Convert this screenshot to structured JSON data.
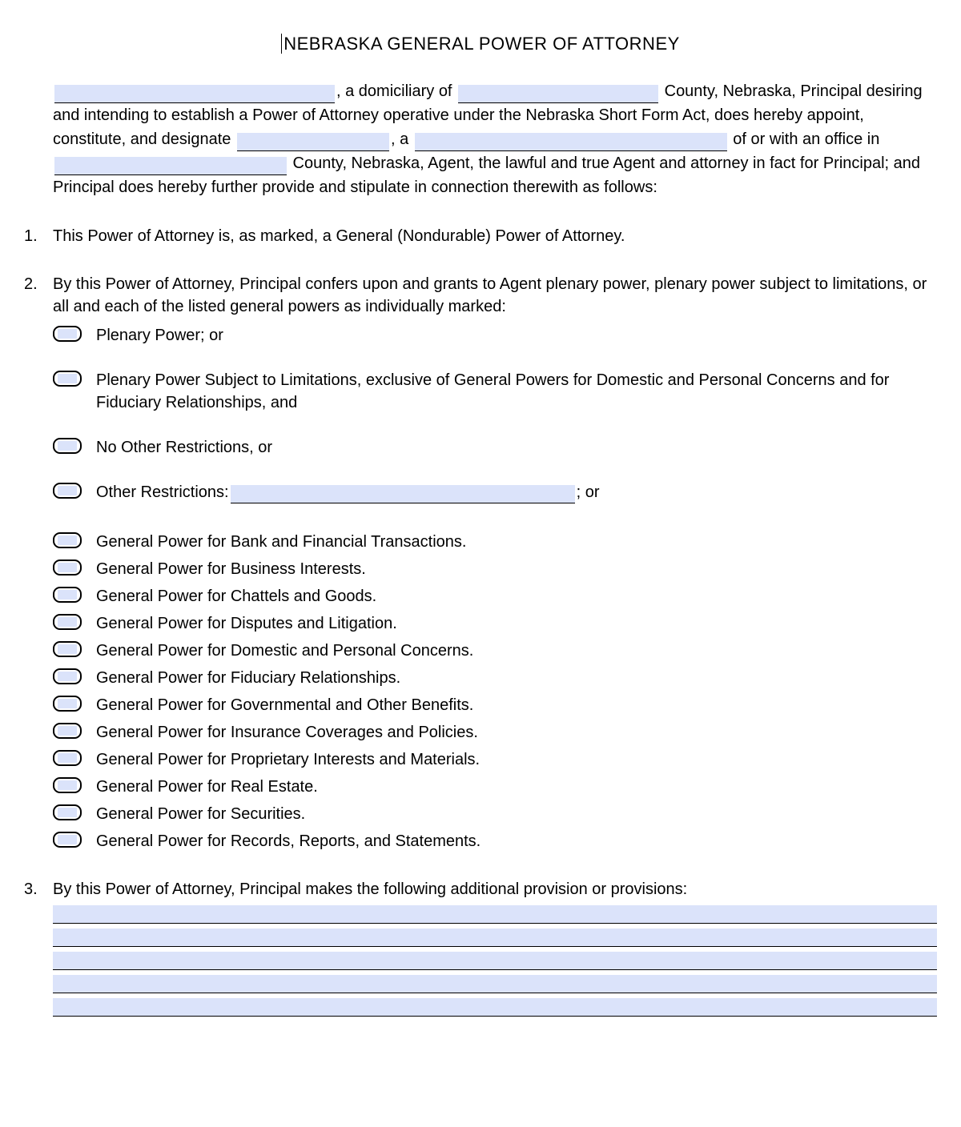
{
  "title": "NEBRASKA GENERAL POWER OF ATTORNEY",
  "intro": {
    "t1": ", a domiciliary of ",
    "t2": " County, Nebraska, Principal desiring and intending to establish a Power of Attorney operative under the Nebraska Short Form Act, does hereby appoint, constitute, and designate ",
    "t3": ", a ",
    "t4": " of or with an office in ",
    "t5": " County, Nebraska, Agent, the lawful and true Agent and attorney in fact for Principal; and Principal does hereby further provide and stipulate in connection therewith as follows:"
  },
  "items": {
    "n1": "1.",
    "n2": "2.",
    "n3": "3.",
    "p1": "This Power of Attorney is, as marked, a General (Nondurable) Power of Attorney.",
    "p2": "By this Power of Attorney, Principal confers upon and grants to Agent plenary power, plenary power subject to limitations, or all and each of the listed general powers as individually marked:",
    "p3": "By this Power of Attorney, Principal makes the following additional provision or provisions:"
  },
  "checks": {
    "c1": "Plenary Power; or",
    "c2": "Plenary Power Subject to Limitations, exclusive of General Powers for Domestic and Personal Concerns and for Fiduciary Relationships, and",
    "c3": "No Other Restrictions, or",
    "c4a": "Other Restrictions:",
    "c4b": "; or",
    "g1": "General Power for Bank and Financial Transactions.",
    "g2": "General Power for Business Interests.",
    "g3": "General Power for Chattels and Goods.",
    "g4": "General Power for Disputes and Litigation.",
    "g5": "General Power for Domestic and Personal Concerns.",
    "g6": "General Power for Fiduciary Relationships.",
    "g7": "General Power for Governmental and Other Benefits.",
    "g8": "General Power for Insurance Coverages and Policies.",
    "g9": "General Power for Proprietary Interests and Materials.",
    "g10": "General Power for Real Estate.",
    "g11": "General Power for Securities.",
    "g12": "General Power for Records, Reports, and Statements."
  }
}
